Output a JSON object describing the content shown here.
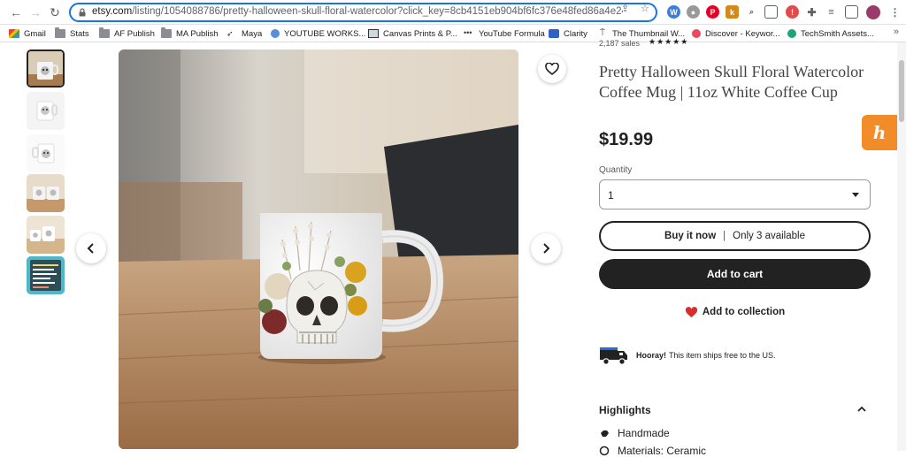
{
  "browser": {
    "url_domain": "etsy.com",
    "url_path": "/listing/1054088786/pretty-halloween-skull-floral-watercolor?click_key=8cb4151eb904bf6fc376e48fed86a4e24f2...",
    "extensions": [
      "wp-icon",
      "chrome-ext-icon",
      "pinterest-icon",
      "k-icon",
      "search-ext-icon",
      "screen-ext-icon",
      "alert-ext-icon",
      "puzzle-icon",
      "playlist-icon",
      "sidebar-icon",
      "profile-avatar"
    ]
  },
  "bookmarks": [
    {
      "label": "Gmail",
      "icon": "gmail-icon"
    },
    {
      "label": "Stats",
      "icon": "folder-icon"
    },
    {
      "label": "AF Publish",
      "icon": "folder-icon"
    },
    {
      "label": "MA Publish",
      "icon": "folder-icon"
    },
    {
      "label": "Maya",
      "icon": "maya-icon"
    },
    {
      "label": "YOUTUBE WORKS...",
      "icon": "globe-icon"
    },
    {
      "label": "Canvas Prints & P...",
      "icon": "canvas-icon"
    },
    {
      "label": "YouTube Formula",
      "icon": "dots-icon"
    },
    {
      "label": "Clarity",
      "icon": "clarity-icon"
    },
    {
      "label": "The Thumbnail W...",
      "icon": "thumbnail-icon"
    },
    {
      "label": "Discover - Keywor...",
      "icon": "discover-icon"
    },
    {
      "label": "TechSmith Assets...",
      "icon": "techsmith-icon"
    }
  ],
  "listing": {
    "sales": "2,187 sales",
    "stars": "★★★★★",
    "title": "Pretty Halloween Skull Floral Watercolor Coffee Mug | 11oz White Coffee Cup",
    "price": "$19.99",
    "quantity_label": "Quantity",
    "quantity_value": "1",
    "buy_now_label": "Buy it now",
    "buy_now_separator": "|",
    "availability": "Only 3 available",
    "add_to_cart_label": "Add to cart",
    "add_to_collection_label": "Add to collection",
    "shipping_bold": "Hooray!",
    "shipping_text": "This item ships free to the US.",
    "highlights_title": "Highlights",
    "highlights": [
      {
        "label": "Handmade",
        "icon": "hand-icon"
      },
      {
        "label": "Materials: Ceramic",
        "icon": "materials-icon"
      }
    ]
  },
  "gallery": {
    "thumbnail_count": 6,
    "active_thumbnail": 1
  },
  "colors": {
    "accent_blue": "#1a73e8",
    "button_dark": "#222222",
    "heart_red": "#d92d2d",
    "honey_orange": "#f28c28"
  }
}
